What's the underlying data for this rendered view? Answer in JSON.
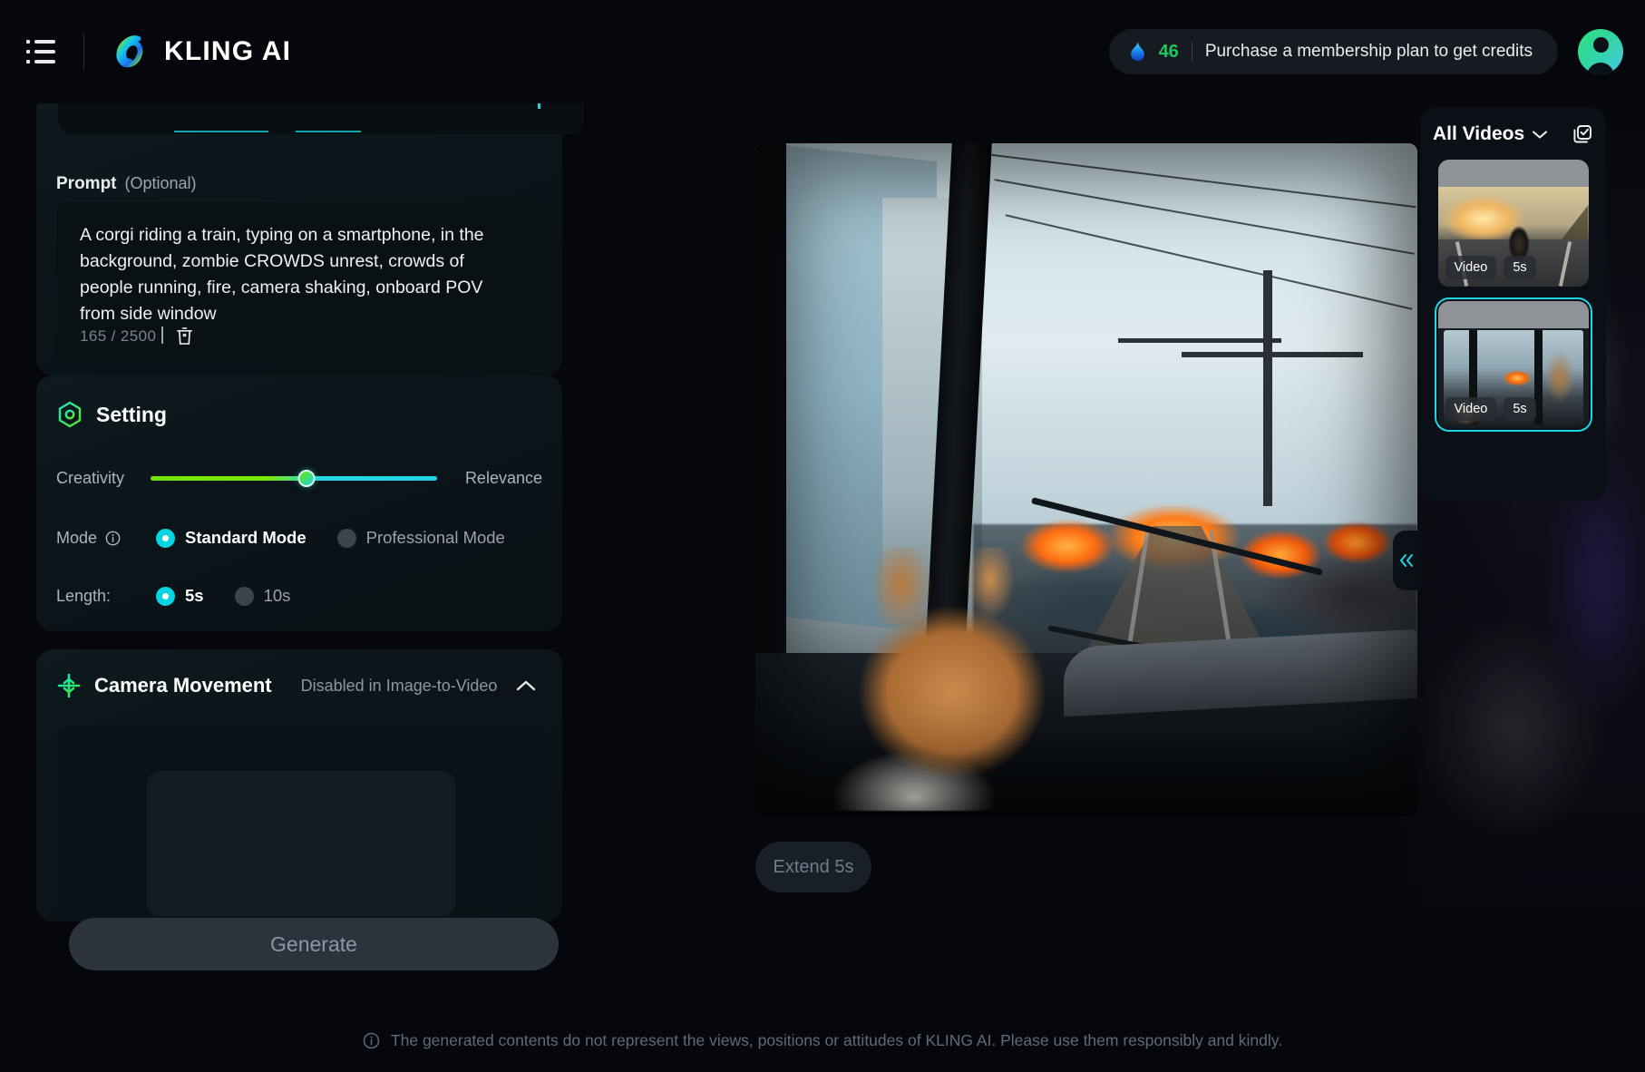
{
  "header": {
    "menu_icon": "list-menu-icon",
    "brand_name": "KLING AI",
    "brand_logo_icon": "kling-infinity-logo",
    "credits": {
      "flame_icon": "flame-icon",
      "count": "46",
      "message": "Purchase a membership plan to get credits"
    },
    "avatar_icon": "user-avatar-icon"
  },
  "left_panel": {
    "prompt": {
      "label": "Prompt",
      "optional": "(Optional)",
      "value": "A corgi riding a train, typing on a smartphone, in the background, zombie CROWDS unrest, crowds of people running, fire, camera shaking, onboard POV from side window",
      "char_count": "165 / 2500",
      "delete_icon": "trash-icon"
    },
    "setting": {
      "icon": "hexagon-settings-icon",
      "title": "Setting",
      "creativity": {
        "left_label": "Creativity",
        "right_label": "Relevance",
        "value_percent": 54.5
      },
      "mode": {
        "label": "Mode",
        "info_icon": "info-circle-icon",
        "options": [
          {
            "label": "Standard Mode",
            "selected": true
          },
          {
            "label": "Professional Mode",
            "selected": false
          }
        ]
      },
      "length": {
        "label": "Length:",
        "options": [
          {
            "label": "5s",
            "selected": true
          },
          {
            "label": "10s",
            "selected": false
          }
        ]
      }
    },
    "camera_movement": {
      "icon": "camera-movement-icon",
      "title": "Camera Movement",
      "note": "Disabled in Image-to-Video",
      "collapse_icon": "chevron-up-icon"
    },
    "generate_button": "Generate"
  },
  "main": {
    "video_preview_name": "generated-video-preview",
    "extend_button": "Extend 5s"
  },
  "right_panel": {
    "title": "All Videos",
    "dropdown_icon": "chevron-down-icon",
    "multi_select_icon": "multi-select-icon",
    "collapse_icon": "double-chevron-left-icon",
    "videos": [
      {
        "type_badge": "Video",
        "duration_badge": "5s",
        "selected": false
      },
      {
        "type_badge": "Video",
        "duration_badge": "5s",
        "selected": true
      }
    ]
  },
  "footer": {
    "info_icon": "info-circle-icon",
    "text": "The generated contents do not represent the views, positions or attitudes of KLING AI. Please use them responsibly and kindly."
  },
  "colors": {
    "accent_cyan": "#07d4e0",
    "accent_green": "#1fc55a",
    "slider_green": "#6ee400",
    "background": "#05070c",
    "card": "#0b1419"
  }
}
